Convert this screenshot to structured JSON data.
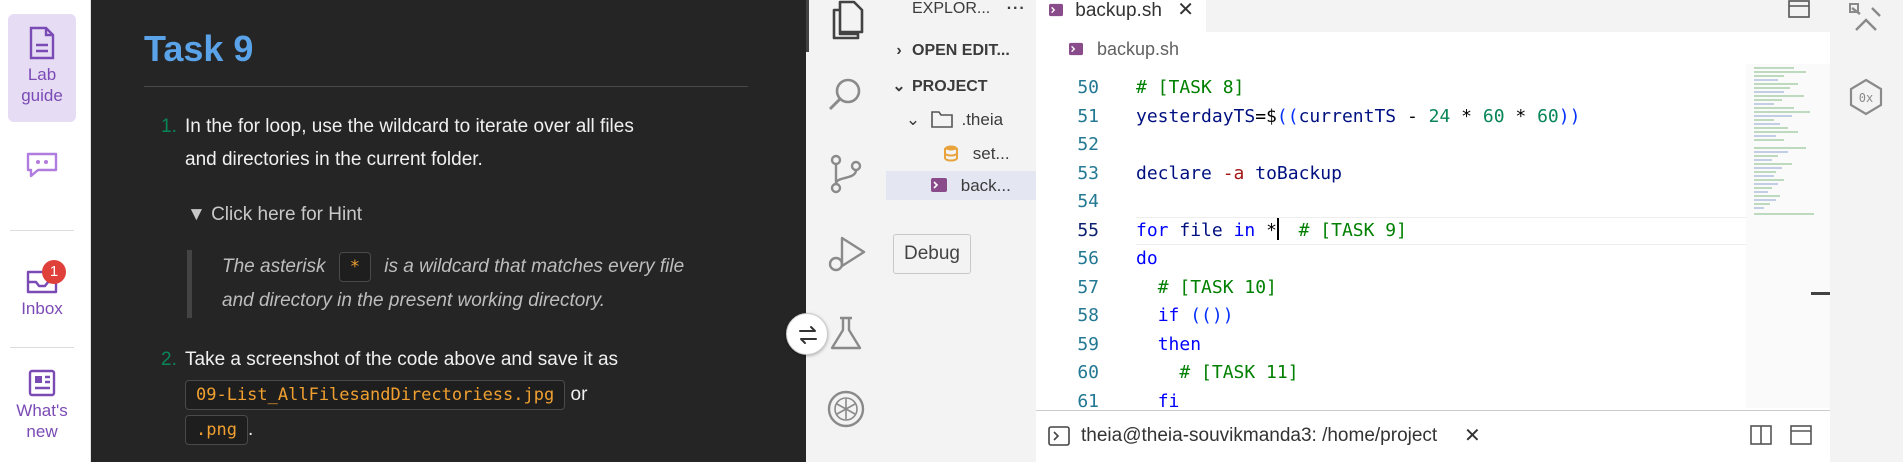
{
  "rail": {
    "lab_guide": "Lab\nguide",
    "inbox": "Inbox",
    "inbox_badge": "1",
    "whats_new": "What's\nnew"
  },
  "guide": {
    "title": "Task 9",
    "step1_num": "1.",
    "step1_line1": "In the for loop, use the wildcard to iterate over all files",
    "step1_line2": "and directories in the current folder.",
    "hint_summary": "▼ Click here for Hint",
    "hint_a": "The asterisk",
    "hint_code": "*",
    "hint_b": "is a wildcard that matches every file",
    "hint_c": "and directory in the present working directory.",
    "step2_num": "2.",
    "step2_line1": "Take a screenshot of the code above and save it as",
    "step2_file1": "09-List_AllFilesandDirectoriess.jpg",
    "step2_or": "or",
    "step2_file2": ".png",
    "step2_end": "."
  },
  "explorer": {
    "header": "EXPLOR...",
    "open_editors": "OPEN EDIT...",
    "project": "PROJECT",
    "theia": ".theia",
    "settings": "set...",
    "backup": "back..."
  },
  "tooltip": "Debug",
  "editor": {
    "tab": "backup.sh",
    "breadcrumb": "backup.sh",
    "lines": [
      {
        "n": "50",
        "parts": [
          [
            "cmt",
            "# [TASK 8]"
          ]
        ]
      },
      {
        "n": "51",
        "parts": [
          [
            "var",
            "yesterdayTS"
          ],
          [
            "",
            "=$"
          ],
          [
            "pun",
            "(("
          ],
          [
            "var",
            "currentTS"
          ],
          [
            "",
            " - "
          ],
          [
            "num",
            "24"
          ],
          [
            "",
            " * "
          ],
          [
            "num",
            "60"
          ],
          [
            "",
            " * "
          ],
          [
            "num",
            "60"
          ],
          [
            "pun",
            "))"
          ]
        ]
      },
      {
        "n": "52",
        "parts": []
      },
      {
        "n": "53",
        "parts": [
          [
            "var",
            "declare"
          ],
          [
            "",
            " "
          ],
          [
            "op",
            "-a"
          ],
          [
            "",
            " "
          ],
          [
            "var",
            "toBackup"
          ]
        ]
      },
      {
        "n": "54",
        "parts": []
      },
      {
        "n": "55",
        "parts": [
          [
            "kw",
            "for"
          ],
          [
            "",
            " "
          ],
          [
            "var",
            "file"
          ],
          [
            "",
            " "
          ],
          [
            "kw",
            "in"
          ],
          [
            "",
            " *  "
          ],
          [
            "cmt",
            "# [TASK 9]"
          ]
        ]
      },
      {
        "n": "56",
        "parts": [
          [
            "kw",
            "do"
          ]
        ]
      },
      {
        "n": "57",
        "parts": [
          [
            "",
            "  "
          ],
          [
            "cmt",
            "# [TASK 10]"
          ]
        ]
      },
      {
        "n": "58",
        "parts": [
          [
            "",
            "  "
          ],
          [
            "kw",
            "if"
          ],
          [
            "",
            " "
          ],
          [
            "pun",
            "(())"
          ]
        ]
      },
      {
        "n": "59",
        "parts": [
          [
            "",
            "  "
          ],
          [
            "kw",
            "then"
          ]
        ]
      },
      {
        "n": "60",
        "parts": [
          [
            "",
            "    "
          ],
          [
            "cmt",
            "# [TASK 11]"
          ]
        ]
      },
      {
        "n": "61",
        "parts": [
          [
            "",
            "  "
          ],
          [
            "kw",
            "fi"
          ]
        ]
      }
    ]
  },
  "terminal": {
    "label": "theia@theia-souvikmanda3: /home/project"
  }
}
